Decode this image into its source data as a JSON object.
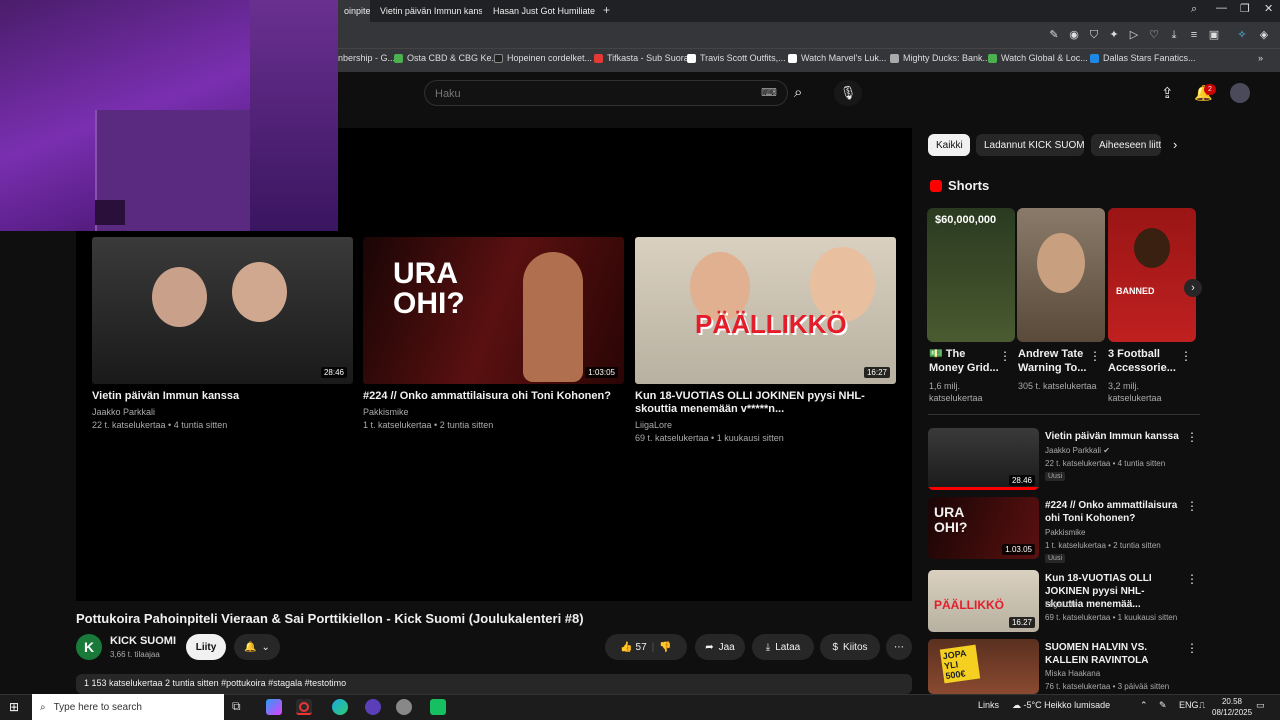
{
  "browser": {
    "tabs": [
      {
        "label": "oinpitel"
      },
      {
        "label": "Vietin päivän Immun kans"
      },
      {
        "label": "Hasan Just Got Humiliate"
      }
    ],
    "new_tab": "+",
    "bookmarks": [
      {
        "label": "nbership - G...",
        "color": "#888"
      },
      {
        "label": "Osta CBD & CBG Ke...",
        "color": "#4caf50"
      },
      {
        "label": "Hopeinen cordelket...",
        "color": "#222"
      },
      {
        "label": "Tifkasta - Sub Suora",
        "color": "#e53935"
      },
      {
        "label": "Travis Scott Outfits,...",
        "color": "#fff"
      },
      {
        "label": "Watch Marvel's Luk...",
        "color": "#fff"
      },
      {
        "label": "Mighty Ducks: Bank...",
        "color": "#aaa"
      },
      {
        "label": "Watch Global & Loc...",
        "color": "#4caf50"
      },
      {
        "label": "Dallas Stars Fanatics...",
        "color": "#1e88e5"
      }
    ]
  },
  "header": {
    "search_placeholder": "Haku",
    "notifications_count": "2"
  },
  "end_cards": [
    {
      "title": "Vietin päivän Immun kanssa",
      "channel": "Jaakko Parkkali",
      "meta": "22 t. katselukertaa • 4 tuntia sitten",
      "duration": "28:46",
      "thumb_bg": "#2a2a2a"
    },
    {
      "title": "#224 // Onko ammattilaisura ohi Toni Kohonen?",
      "channel": "Pakkismike",
      "meta": "1 t. katselukertaa • 2 tuntia sitten",
      "duration": "1:03:05",
      "thumb_text": "URA OHI?",
      "thumb_bg": "#3a0a0a"
    },
    {
      "title": "Kun 18-VUOTIAS OLLI JOKINEN pyysi NHL-skouttia menemään v*****n...",
      "channel": "LiigaLore",
      "meta": "69 t. katselukertaa • 1 kuukausi sitten",
      "duration": "16:27",
      "thumb_text": "PÄÄLLIKKÖ",
      "thumb_bg": "#d9d0c0"
    }
  ],
  "video": {
    "title": "Pottukoira Pahoinpiteli Vieraan & Sai Porttikiellon - Kick Suomi (Joulukalenteri #8)",
    "channel": "KICK SUOMI",
    "subscribers": "3,66 t. tilaajaa",
    "join_label": "Liity",
    "likes": "57",
    "share_label": "Jaa",
    "download_label": "Lataa",
    "thanks_label": "Kiitos",
    "description": "1 153 katselukertaa  2 tuntia sitten  #pottukoira #stagala #testotimo"
  },
  "sidebar": {
    "chips": [
      "Kaikki",
      "Ladannut KICK SUOMI",
      "Aiheeseen liitt"
    ],
    "shorts_heading": "Shorts",
    "shorts": [
      {
        "title": "The Money Grid...",
        "meta": "1,6 milj. katselukertaa",
        "overlay": "$60,000,000",
        "bg": "#3a4a2a"
      },
      {
        "title": "Andrew Tate Warning To...",
        "meta": "305 t. katselukertaa",
        "overlay": "",
        "bg": "#6a5a4a"
      },
      {
        "title": "3 Football Accessorie...",
        "meta": "3,2 milj. katselukertaa",
        "overlay": "BANNED",
        "bg": "#b02020"
      }
    ],
    "recommended": [
      {
        "title": "Vietin päivän Immun kanssa",
        "channel": "Jaakko Parkkali",
        "meta": "22 t. katselukertaa • 4 tuntia sitten",
        "badge": "Uusi",
        "duration": "28.46",
        "bg": "#2a2a2a"
      },
      {
        "title": "#224 // Onko ammattilaisura ohi Toni Kohonen?",
        "channel": "Pakkismike",
        "meta": "1 t. katselukertaa • 2 tuntia sitten",
        "badge": "Uusi",
        "duration": "1.03.05",
        "thumb_text": "URA OHI?",
        "bg": "#3a0a0a"
      },
      {
        "title": "Kun 18-VUOTIAS OLLI JOKINEN pyysi NHL-skouttia menemää...",
        "channel": "LiigaLore",
        "meta": "69 t. katselukertaa • 1 kuukausi sitten",
        "badge": "",
        "duration": "16.27",
        "thumb_text": "PÄÄLLIKKÖ",
        "bg": "#d9d0c0"
      },
      {
        "title": "SUOMEN HALVIN VS. KALLEIN RAVINTOLA",
        "channel": "Miska Haakana",
        "meta": "76 t. katselukertaa • 3 päivää sitten",
        "badge": "",
        "duration": "",
        "thumb_text": "JOPA YLI 500€",
        "bg": "#5a3020"
      }
    ]
  },
  "taskbar": {
    "search_placeholder": "Type here to search",
    "links": "Links",
    "weather": "-5°C  Heikko lumisade",
    "lang": "ENG",
    "time": "20.58",
    "date": "08/12/2025"
  }
}
